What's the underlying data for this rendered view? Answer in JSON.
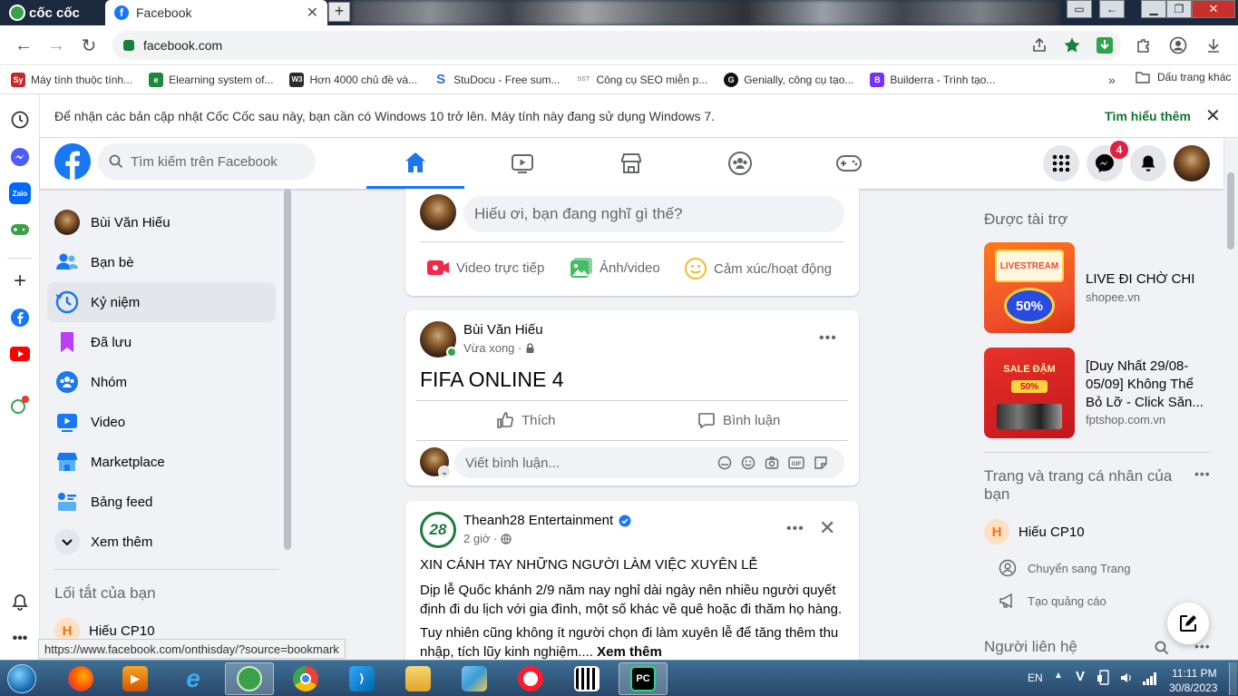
{
  "browser": {
    "logo_text": "cốc cốc",
    "tab_title": "Facebook",
    "url": "facebook.com",
    "bookmarks": [
      {
        "label": "Máy tính thuộc tính...",
        "icon": "Sy",
        "color": "#c62828"
      },
      {
        "label": "Elearning system of...",
        "icon": "e",
        "color": "#1b8a3d"
      },
      {
        "label": "Hơn 4000 chủ đề và...",
        "icon": "W3",
        "color": "#2b2b2b"
      },
      {
        "label": "StuDocu - Free sum...",
        "icon": "S",
        "color": "#2c6fd6"
      },
      {
        "label": "Công cụ SEO miễn p...",
        "icon": "SST",
        "color": "#9e9e9e"
      },
      {
        "label": "Genially, công cụ tạo...",
        "icon": "G",
        "color": "#111111"
      },
      {
        "label": "Builderra - Trình tạo...",
        "icon": "B",
        "color": "#7b2ff7"
      }
    ],
    "bookmarks_more": "»",
    "bookmarks_folder": "Dấu trang khác",
    "notice_text": "Để nhận các bản cập nhật Cốc Cốc sau này, bạn cần có Windows 10 trở lên. Máy tính này đang sử dụng Windows 7.",
    "notice_link": "Tìm hiểu thêm",
    "status_url": "https://www.facebook.com/onthisday/?source=bookmark"
  },
  "facebook": {
    "search_placeholder": "Tìm kiếm trên Facebook",
    "messenger_badge": "4",
    "left_nav": [
      {
        "label": "Bùi Văn Hiếu",
        "icon": "avatar"
      },
      {
        "label": "Bạn bè",
        "icon": "friends-icon"
      },
      {
        "label": "Kỷ niệm",
        "icon": "memories-icon"
      },
      {
        "label": "Đã lưu",
        "icon": "saved-icon"
      },
      {
        "label": "Nhóm",
        "icon": "groups-icon"
      },
      {
        "label": "Video",
        "icon": "video-icon"
      },
      {
        "label": "Marketplace",
        "icon": "marketplace-icon"
      },
      {
        "label": "Bảng feed",
        "icon": "feed-icon"
      },
      {
        "label": "Xem thêm",
        "icon": "chevron-down-icon"
      }
    ],
    "shortcuts_title": "Lối tắt của bạn",
    "shortcuts": [
      {
        "label": "Hiếu CP10",
        "initial": "H"
      }
    ],
    "composer": {
      "placeholder": "Hiếu ơi, bạn đang nghĩ gì thế?",
      "live": "Video trực tiếp",
      "photo": "Ảnh/video",
      "feeling": "Cảm xúc/hoạt động"
    },
    "post1": {
      "author": "Bùi Văn Hiếu",
      "time": "Vừa xong ·",
      "text": "FIFA ONLINE 4",
      "like": "Thích",
      "comment": "Bình luận",
      "comment_placeholder": "Viết bình luận..."
    },
    "post2": {
      "author": "Theanh28 Entertainment",
      "avatar_text": "28",
      "time": "2 giờ ·",
      "headline": "XIN CÁNH TAY NHỮNG NGƯỜI LÀM VIỆC XUYÊN LỄ",
      "para1": "Dịp lễ Quốc khánh 2/9 năm nay nghỉ dài ngày nên nhiều người quyết định đi du lịch với gia đình, một số khác về quê hoặc đi thăm họ hàng.",
      "para2": "Tuy nhiên cũng không ít người chọn đi làm xuyên lễ để tăng thêm thu nhập, tích lũy kinh nghiệm....",
      "see_more": "Xem thêm"
    },
    "right": {
      "sponsored_title": "Được tài trợ",
      "ads": [
        {
          "title": "LIVE ĐI CHỜ CHI",
          "source": "shopee.vn",
          "badge": "50%",
          "banner": "LIVESTREAM"
        },
        {
          "title": "[Duy Nhất 29/08-05/09] Không Thể Bỏ Lỡ - Click Săn...",
          "source": "fptshop.com.vn",
          "badge": "50%",
          "banner": "SALE ĐẬM"
        }
      ],
      "pages_title": "Trang và trang cá nhân của bạn",
      "page_name": "Hiếu CP10",
      "page_initial": "H",
      "switch_page": "Chuyển sang Trang",
      "create_ad": "Tạo quảng cáo",
      "contacts_title": "Người liên hệ"
    }
  },
  "taskbar": {
    "lang": "EN",
    "time": "11:11 PM",
    "date": "30/8/2023"
  },
  "colors": {
    "fb_blue": "#1877f2",
    "badge_red": "#e41e3f",
    "notice_link": "#137333"
  }
}
